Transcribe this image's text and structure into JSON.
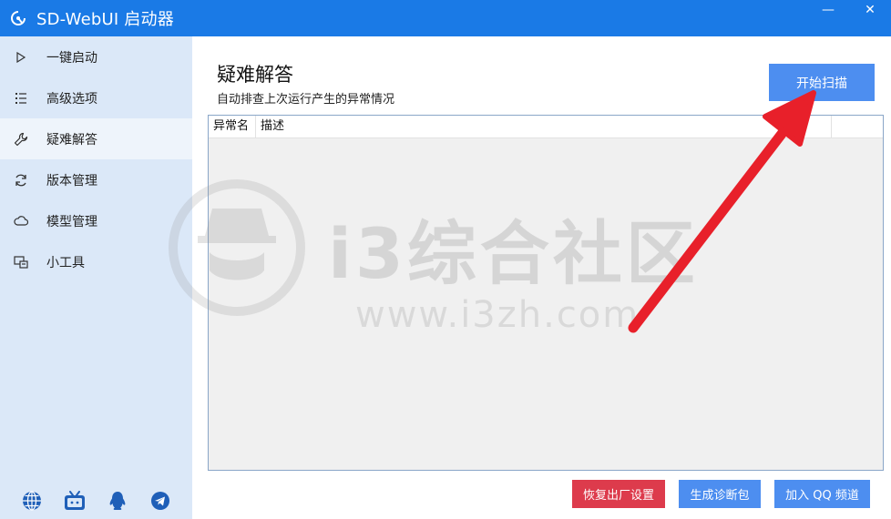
{
  "window": {
    "title": "SD-WebUI 启动器",
    "app_icon": "launcher-logo-icon",
    "minimize_glyph": "—",
    "close_glyph": "✕"
  },
  "sidebar": {
    "items": [
      {
        "label": "一键启动",
        "icon": "play-icon"
      },
      {
        "label": "高级选项",
        "icon": "list-icon"
      },
      {
        "label": "疑难解答",
        "icon": "wrench-icon",
        "active": true
      },
      {
        "label": "版本管理",
        "icon": "refresh-icon"
      },
      {
        "label": "模型管理",
        "icon": "cloud-icon"
      },
      {
        "label": "小工具",
        "icon": "tools-icon"
      }
    ],
    "footer_icons": [
      "globe-icon",
      "bilibili-icon",
      "qq-icon",
      "telegram-icon"
    ]
  },
  "main": {
    "title": "疑难解答",
    "subtitle": "自动排查上次运行产生的异常情况",
    "scan_button": "开始扫描",
    "table": {
      "columns": [
        "异常名",
        "描述"
      ],
      "rows": []
    },
    "buttons": {
      "reset": "恢复出厂设置",
      "diagnostic": "生成诊断包",
      "qq_channel": "加入 QQ 频道"
    }
  },
  "watermark": {
    "text": "i3综合社区",
    "url": "www.i3zh.com"
  },
  "colors": {
    "titlebar": "#1a7ae6",
    "sidebar": "#dbe8f8",
    "primary_button": "#4d8ef0",
    "danger_button": "#dd3b4c",
    "annotation_arrow": "#e8202a"
  }
}
